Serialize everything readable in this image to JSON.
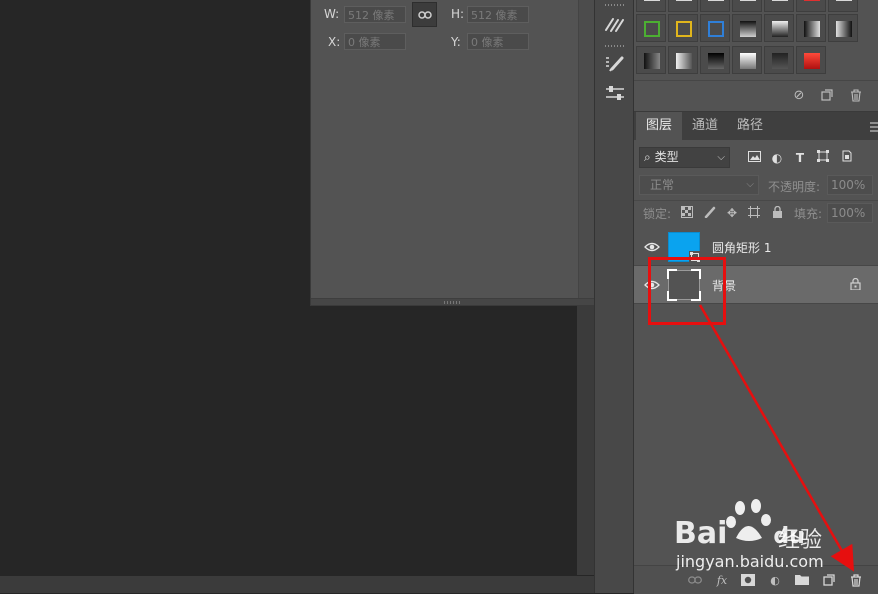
{
  "properties": {
    "w_label": "W:",
    "w_value": "512 像素",
    "h_label": "H:",
    "h_value": "512 像素",
    "x_label": "X:",
    "x_value": "0 像素",
    "y_label": "Y:",
    "y_value": "0 像素"
  },
  "styles": {
    "row0": [
      "#d9d9d9",
      "#d9d9d9",
      "#d9d9d9",
      "#d9d9d9",
      "#d9d9d9",
      "#e03030",
      "#d9d9d9"
    ],
    "row1": [
      {
        "kind": "outline",
        "color": "#4caf32"
      },
      {
        "kind": "outline",
        "color": "#e0b51c"
      },
      {
        "kind": "outline",
        "color": "#2f7fd8"
      },
      {
        "kind": "gradient",
        "from": "#111111",
        "to": "#d0d0d0"
      },
      {
        "kind": "gradient",
        "from": "#f0f0f0",
        "to": "#222222"
      },
      {
        "kind": "hgradient",
        "from": "#111111",
        "to": "#e0e0e0"
      },
      {
        "kind": "hgradient",
        "from": "#e0e0e0",
        "to": "#111111"
      }
    ],
    "row2": [
      {
        "kind": "hgradient",
        "from": "#111111",
        "to": "#888888"
      },
      {
        "kind": "hgradient",
        "from": "#f0f0f0",
        "to": "#555555"
      },
      {
        "kind": "gradient",
        "from": "#000000",
        "to": "#666666"
      },
      {
        "kind": "gradient",
        "from": "#ffffff",
        "to": "#777777"
      },
      {
        "kind": "gradient",
        "from": "#222222",
        "to": "#555555"
      },
      {
        "kind": "gradient",
        "from": "#ff4a3a",
        "to": "#b01010"
      }
    ]
  },
  "layers_panel": {
    "tabs": [
      "图层",
      "通道",
      "路径"
    ],
    "kind_filter": "类型",
    "blend_mode": "正常",
    "opacity_label": "不透明度:",
    "opacity_value": "100%",
    "lock_label": "锁定:",
    "fill_label": "填充:",
    "fill_value": "100%",
    "layers": [
      {
        "name": "圆角矩形 1",
        "thumb_color": "#0aa3ef",
        "visible": true,
        "selected": false,
        "locked": false
      },
      {
        "name": "背景",
        "thumb_color": "#535353",
        "visible": true,
        "selected": true,
        "locked": true
      }
    ]
  },
  "colors": {
    "canvas_bg": "#262626",
    "panel_bg": "#535353",
    "annotation_red": "#e60f0f"
  },
  "watermark": {
    "brand": "Bai",
    "brand_suffix": "du",
    "chinese": "经验",
    "url": "jingyan.baidu.com"
  }
}
